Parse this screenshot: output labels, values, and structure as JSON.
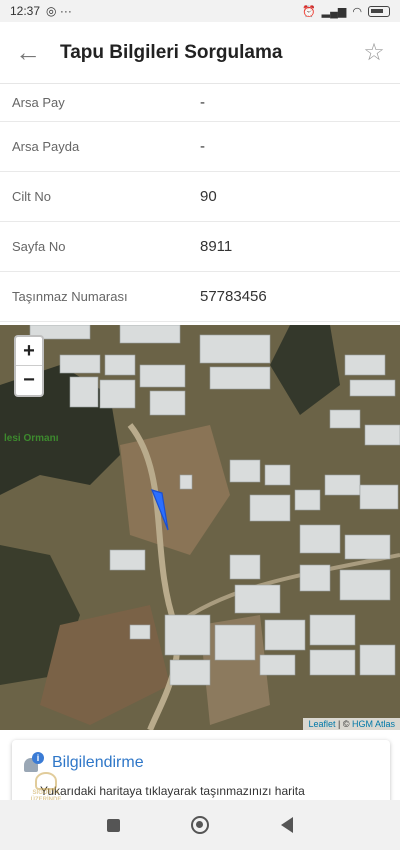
{
  "status_bar": {
    "time": "12:37",
    "extra": "◎ ···"
  },
  "app_bar": {
    "title": "Tapu Bilgileri Sorgulama",
    "back_icon": "arrow-left-icon",
    "favorite_icon": "star-outline-icon"
  },
  "info_rows": [
    {
      "label": "Arsa Pay",
      "value": "-"
    },
    {
      "label": "Arsa Payda",
      "value": "-"
    },
    {
      "label": "Cilt No",
      "value": "90"
    },
    {
      "label": "Sayfa No",
      "value": "8911"
    },
    {
      "label": "Taşınmaz Numarası",
      "value": "57783456"
    }
  ],
  "map": {
    "zoom_in": "+",
    "zoom_out": "−",
    "attribution_leaflet": "Leaflet",
    "attribution_sep": " | © ",
    "attribution_source": "HGM Atlas",
    "place_label": "lesi Ormanı",
    "parcel_color": "#2b6fff"
  },
  "info_card": {
    "title": "Bilgilendirme",
    "text": "Yukarıdaki haritaya tıklayarak taşınmazınızı harita",
    "title_color": "#2f77c8"
  },
  "watermark": {
    "line1": "SİGORTA",
    "line2": "ÜZERİNDE"
  },
  "nav_bar": {
    "recent": "recent-apps-icon",
    "home": "home-icon",
    "back": "back-icon"
  }
}
